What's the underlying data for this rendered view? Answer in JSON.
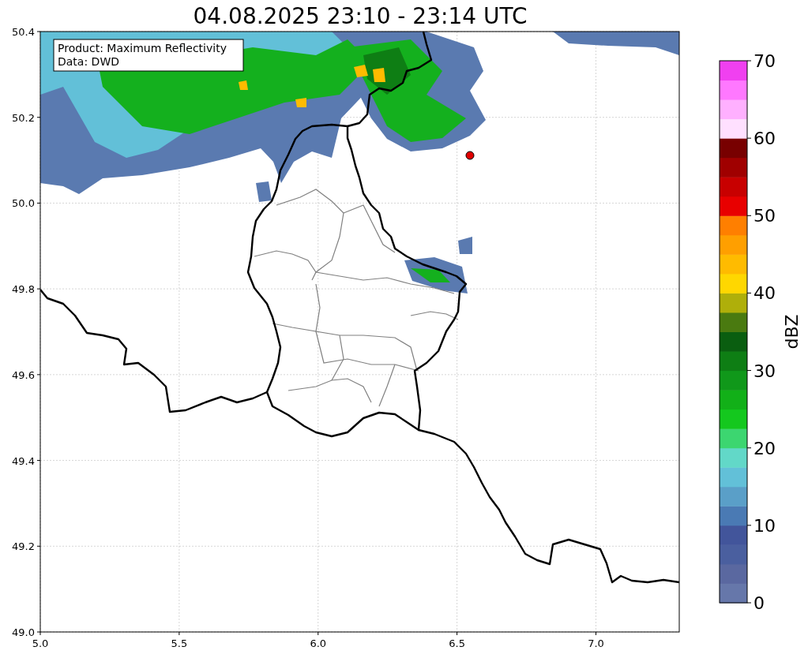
{
  "title": "04.08.2025 23:10 - 23:14 UTC",
  "map": {
    "info_box": [
      "Product: Maximum Reflectivity",
      "Data: DWD"
    ],
    "x_ticks": [
      "5.0",
      "5.5",
      "6.0",
      "6.5",
      "7.0"
    ],
    "y_ticks": [
      "50.4",
      "50.2",
      "50.0",
      "49.8",
      "49.6",
      "49.4",
      "49.2",
      "49.0"
    ]
  },
  "colorbar": {
    "label": "dBZ",
    "ticks": [
      "70",
      "60",
      "50",
      "40",
      "30",
      "20",
      "10",
      "0"
    ],
    "segments": [
      {
        "color": "#6677aa"
      },
      {
        "color": "#5a68a0"
      },
      {
        "color": "#4a5f9f"
      },
      {
        "color": "#42559b"
      },
      {
        "color": "#4a7ab4"
      },
      {
        "color": "#5a9fc8"
      },
      {
        "color": "#62c0d8"
      },
      {
        "color": "#62d8c8"
      },
      {
        "color": "#3cd670"
      },
      {
        "color": "#14c81e"
      },
      {
        "color": "#12b018"
      },
      {
        "color": "#10981a"
      },
      {
        "color": "#0e7e14"
      },
      {
        "color": "#0a5e10"
      },
      {
        "color": "#4a7a10"
      },
      {
        "color": "#afaf0a"
      },
      {
        "color": "#ffd700"
      },
      {
        "color": "#ffbb00"
      },
      {
        "color": "#ff9f00"
      },
      {
        "color": "#ff7f00"
      },
      {
        "color": "#e80000"
      },
      {
        "color": "#c80000"
      },
      {
        "color": "#a00000"
      },
      {
        "color": "#780000"
      },
      {
        "color": "#ffe0ff"
      },
      {
        "color": "#ffb0ff"
      },
      {
        "color": "#ff78ff"
      },
      {
        "color": "#f040f0"
      }
    ]
  }
}
